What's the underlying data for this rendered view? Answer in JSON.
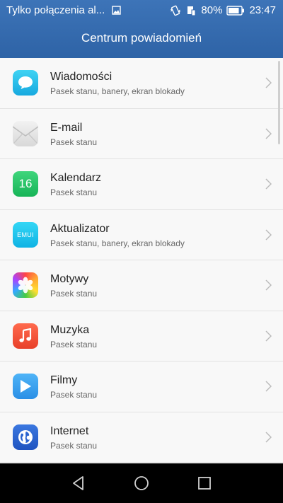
{
  "status_bar": {
    "left_text": "Tylko połączenia al...",
    "battery_percent": "80%",
    "time": "23:47",
    "icons": [
      "image-icon",
      "vibrate-icon",
      "sim-icon",
      "battery-icon"
    ]
  },
  "header": {
    "title": "Centrum powiadomień"
  },
  "items": [
    {
      "title": "Wiadomości",
      "subtitle": "Pasek stanu, banery, ekran blokady",
      "icon": "messages-icon"
    },
    {
      "title": "E-mail",
      "subtitle": "Pasek stanu",
      "icon": "email-icon"
    },
    {
      "title": "Kalendarz",
      "subtitle": "Pasek stanu",
      "icon": "calendar-icon",
      "icon_text": "16"
    },
    {
      "title": "Aktualizator",
      "subtitle": "Pasek stanu, banery, ekran blokady",
      "icon": "updater-icon",
      "icon_text": "EMUI"
    },
    {
      "title": "Motywy",
      "subtitle": "Pasek stanu",
      "icon": "themes-icon"
    },
    {
      "title": "Muzyka",
      "subtitle": "Pasek stanu",
      "icon": "music-icon"
    },
    {
      "title": "Filmy",
      "subtitle": "Pasek stanu",
      "icon": "videos-icon"
    },
    {
      "title": "Internet",
      "subtitle": "Pasek stanu",
      "icon": "internet-icon"
    }
  ],
  "colors": {
    "header": "#3568ad",
    "background": "#f8f8f8",
    "navbar": "#000000"
  },
  "navigation": [
    "back-icon",
    "home-icon",
    "recents-icon"
  ]
}
